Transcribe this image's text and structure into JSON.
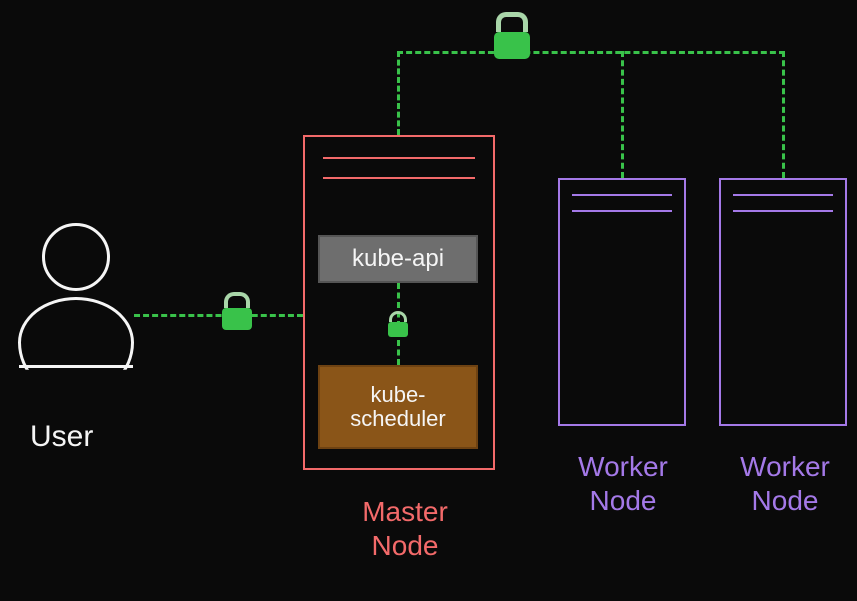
{
  "user": {
    "label": "User"
  },
  "master": {
    "label": "Master\nNode",
    "kube_api": "kube-api",
    "kube_scheduler": "kube-\nscheduler"
  },
  "workers": [
    {
      "label": "Worker\nNode"
    },
    {
      "label": "Worker\nNode"
    }
  ],
  "icons": {
    "lock_user_master": "lock-icon",
    "lock_top": "lock-icon",
    "lock_api_scheduler": "lock-icon"
  }
}
